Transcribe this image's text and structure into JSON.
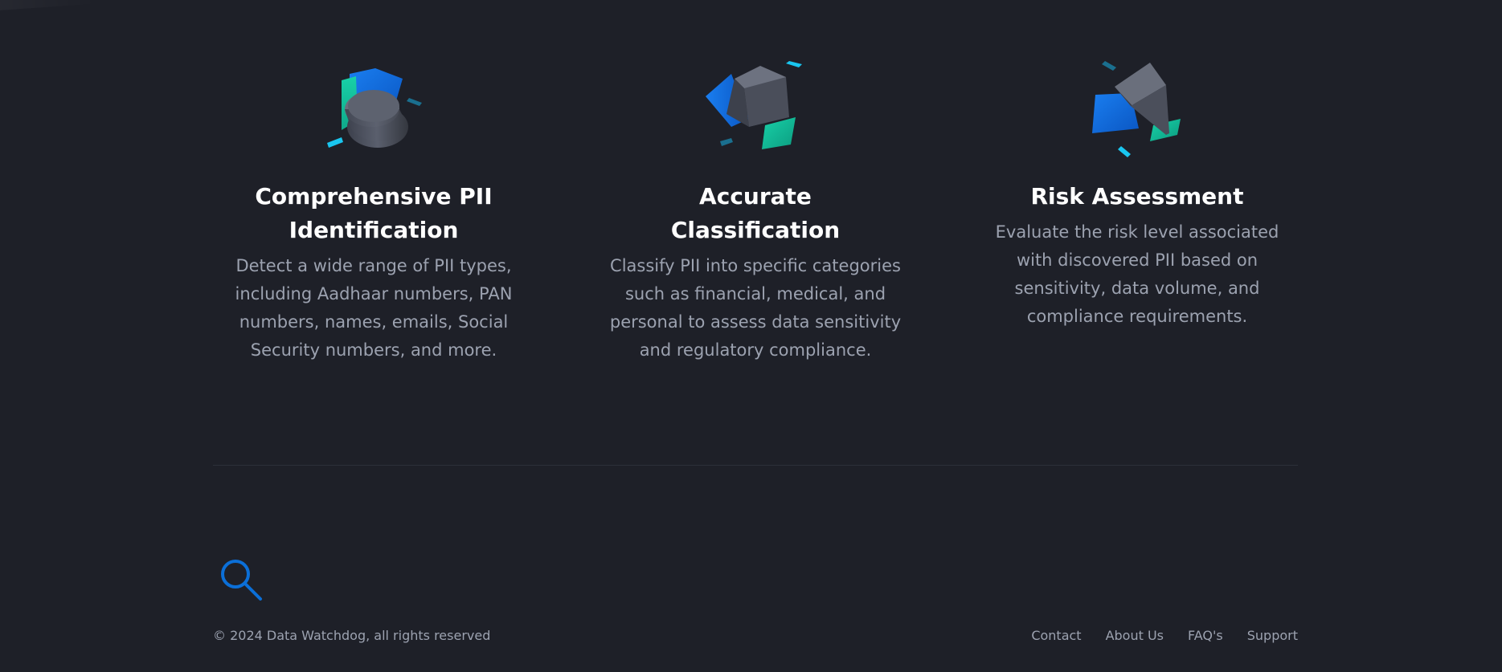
{
  "features": [
    {
      "icon": "cylinder-shape-icon",
      "title": "Comprehensive PII Identification",
      "description": "Detect a wide range of PII types, including Aadhaar numbers, PAN numbers, names, emails, Social Security numbers, and more."
    },
    {
      "icon": "cube-shape-icon",
      "title": "Accurate Classification",
      "description": "Classify PII into specific categories such as financial, medical, and personal to assess data sensitivity and regulatory compliance."
    },
    {
      "icon": "prism-shape-icon",
      "title": "Risk Assessment",
      "description": "Evaluate the risk level associated with discovered PII based on sensitivity, data volume, and compliance requirements."
    }
  ],
  "footer": {
    "logo_icon": "magnifier-icon",
    "copyright": "© 2024 Data Watchdog, all rights reserved",
    "links": [
      "Contact",
      "About Us",
      "FAQ's",
      "Support"
    ]
  },
  "colors": {
    "background": "#1e2028",
    "accent_blue": "#0b6fd8",
    "accent_teal": "#13c4a3",
    "accent_cyan": "#19c6f0",
    "text_muted": "#9ca2b0"
  }
}
